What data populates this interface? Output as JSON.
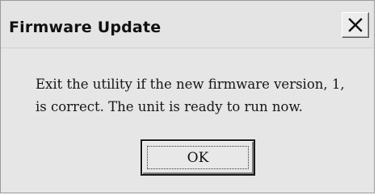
{
  "dialog": {
    "title": "Firmware Update",
    "close_icon": "close-x-icon",
    "message_lines": [
      "Exit the utility if the new firmware version,  1,",
      "is correct. The unit is ready to run now."
    ],
    "ok_label": "OK"
  },
  "colors": {
    "dialog_background": "#e6e6e6",
    "text": "#111111"
  }
}
